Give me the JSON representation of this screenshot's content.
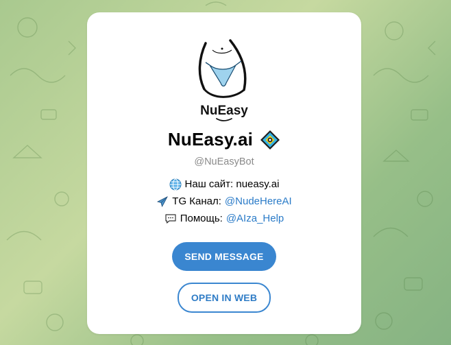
{
  "bot": {
    "name": "NuEasy.ai",
    "username": "@NuEasyBot",
    "logo_text": "NuEasy"
  },
  "description": {
    "site_label": "Наш сайт: nueasy.ai",
    "channel_label": "TG Канал: ",
    "channel_link": "@NudeHereAI",
    "help_label": "Помощь: ",
    "help_link": "@AIza_Help"
  },
  "buttons": {
    "send": "SEND MESSAGE",
    "web": "OPEN IN WEB"
  },
  "colors": {
    "accent": "#3a86d0",
    "link": "#2a7bc8",
    "background": "#a9c98f"
  },
  "icons": {
    "site": "globe-icon",
    "channel": "airplane-icon",
    "help": "speech-bubble-icon",
    "verified": "diamond-badge-icon"
  }
}
